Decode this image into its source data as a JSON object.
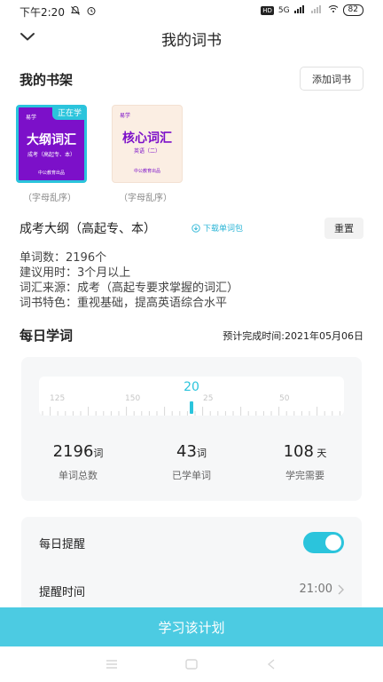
{
  "status_bar": {
    "time": "下午2:20",
    "hd": "HD",
    "network": "5G",
    "battery": "82"
  },
  "header": {
    "title": "我的词书"
  },
  "shelf": {
    "title": "我的书架",
    "add_button": "添加词书",
    "books": [
      {
        "badge": "正在学",
        "publisher": "易学",
        "title": "大纲词汇",
        "subtitle": "成考（高起专、本）",
        "footer": "中公教育出品",
        "caption": "（字母乱序）"
      },
      {
        "publisher": "易学",
        "title": "核心词汇",
        "subtitle": "英语（二）",
        "footer": "中公教育出品",
        "caption": "（字母乱序）"
      }
    ]
  },
  "plan": {
    "title": "成考大纲（高起专、本）",
    "download_link": "下载单词包",
    "reset_button": "重置",
    "info": [
      "单词数：2196个",
      "建议用时：3个月以上",
      "词汇来源：成考（高起专要求掌握的词汇）",
      "词书特色：重视基础，提高英语综合水平"
    ]
  },
  "daily": {
    "title": "每日学词",
    "finish_time": "预计完成时间:2021年05月06日",
    "selected_value": "20",
    "tick_labels": [
      "125",
      "150",
      "25",
      "50"
    ],
    "stats": [
      {
        "value": "2196",
        "unit": "词",
        "label": "单词总数"
      },
      {
        "value": "43",
        "unit": "词",
        "label": "已学单词"
      },
      {
        "value": "108",
        "unit": " 天",
        "label": "学完需要"
      }
    ]
  },
  "reminder": {
    "daily_label": "每日提醒",
    "daily_enabled": true,
    "time_label": "提醒时间",
    "time_value": "21:00"
  },
  "footer": {
    "study_button": "学习该计划"
  },
  "colors": {
    "accent": "#2bc4dc",
    "button": "#4ccbe2",
    "book_purple": "#7c10c9"
  }
}
